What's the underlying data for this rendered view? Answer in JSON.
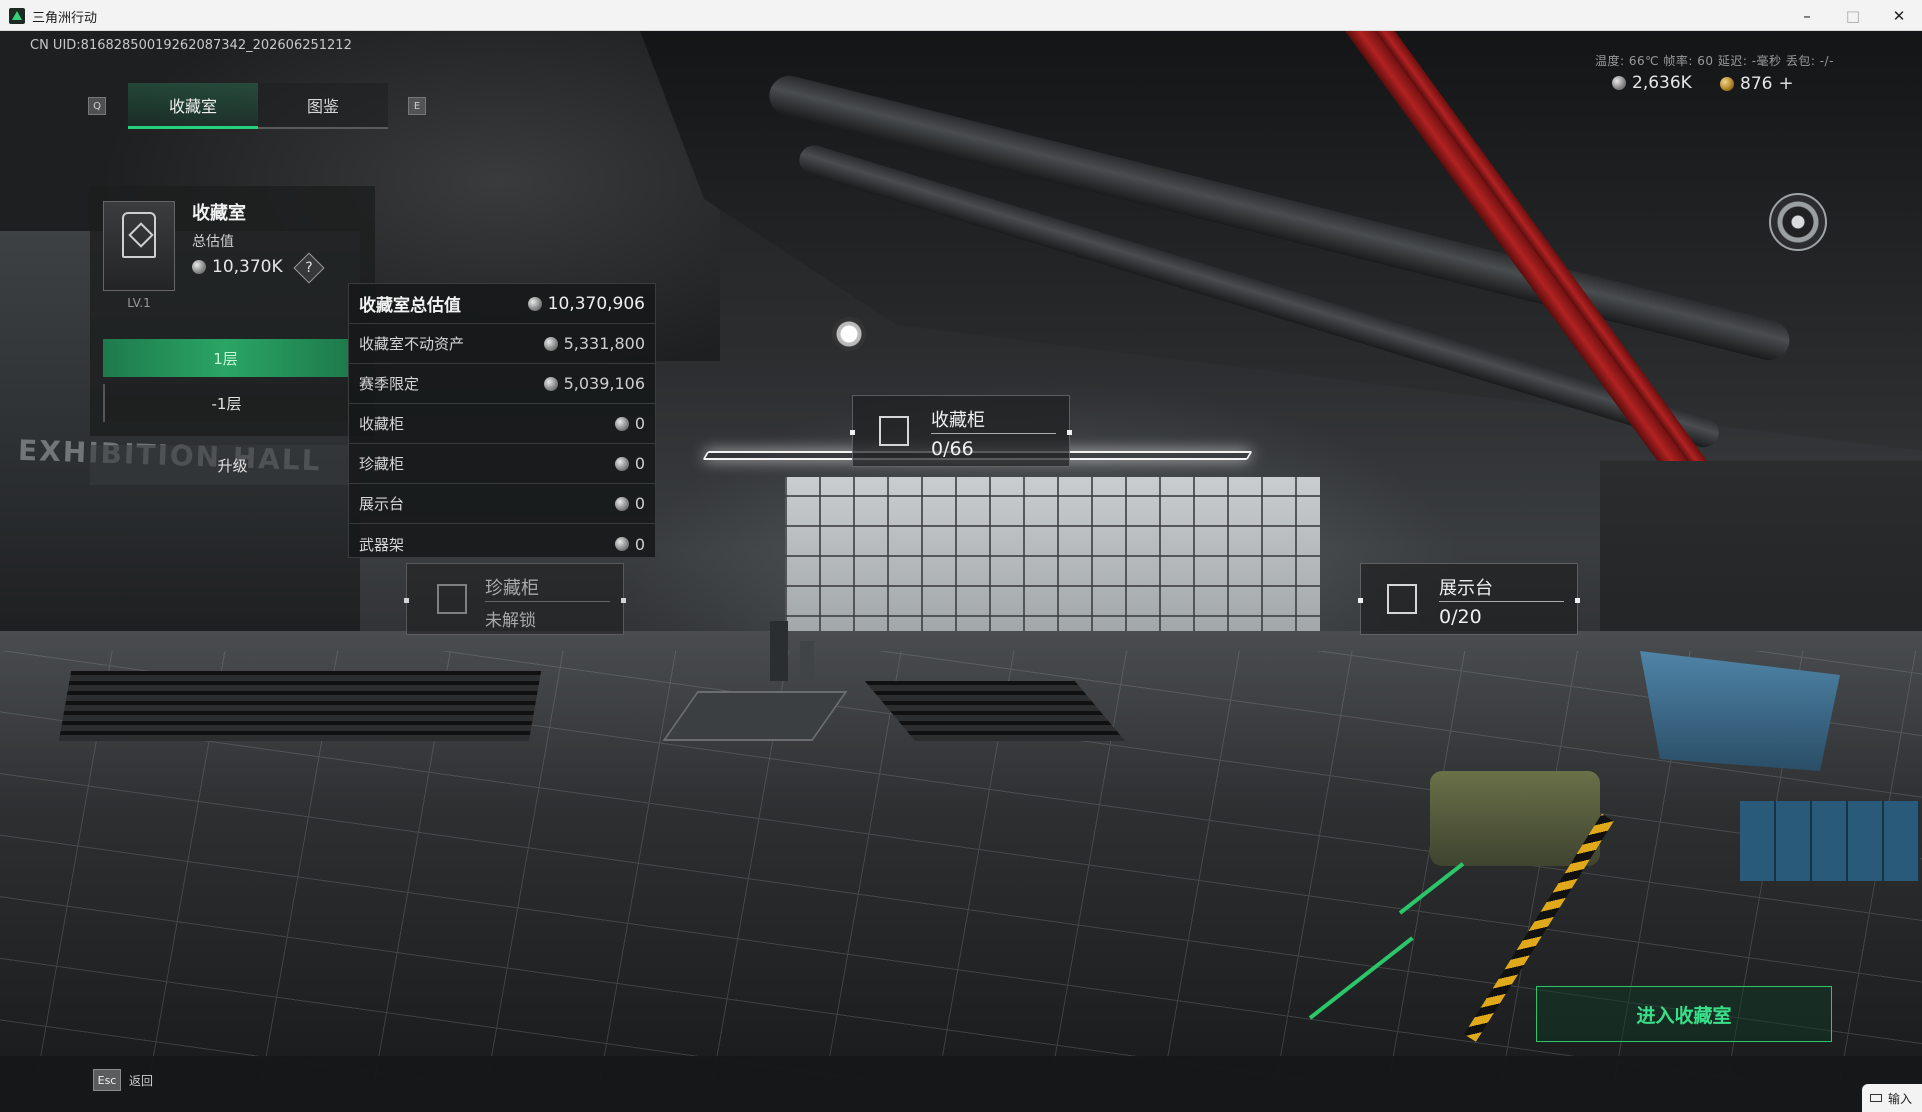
{
  "window": {
    "title": "三角洲行动",
    "minimize": "–",
    "maximize": "□",
    "close": "✕"
  },
  "hud": {
    "uid": "CN UID:8168285001926208734​2_202606251212",
    "stats": "温度:  66℃    帧率: 60    延迟: -毫秒    丢包: -/-",
    "silver": "2,636K",
    "gold": "876",
    "plus": "+"
  },
  "tabs": {
    "key_left": "Q",
    "key_right": "E",
    "items": [
      {
        "label": "收藏室",
        "active": true
      },
      {
        "label": "图鉴",
        "active": false
      }
    ]
  },
  "panel": {
    "title": "收藏室",
    "subtitle": "总估值",
    "value": "10,370K",
    "help": "?",
    "level": "LV.1",
    "floors": [
      {
        "label": "1层",
        "active": true
      },
      {
        "label": "-1层",
        "active": false
      }
    ],
    "upgrade": "升级",
    "wall_text": "EXHIBITION HALL"
  },
  "breakdown": {
    "rows": [
      {
        "label": "收藏室总估值",
        "value": "10,370,906"
      },
      {
        "label": "收藏室不动资产",
        "value": "5,331,800"
      },
      {
        "label": "赛季限定",
        "value": "5,039,106"
      },
      {
        "label": "收藏柜",
        "value": "0"
      },
      {
        "label": "珍藏柜",
        "value": "0"
      },
      {
        "label": "展示台",
        "value": "0"
      },
      {
        "label": "武器架",
        "value": "0"
      }
    ]
  },
  "hotspots": {
    "cabinet": {
      "name": "收藏柜",
      "value": "0/66"
    },
    "vault": {
      "name": "珍藏柜",
      "value": "未解锁"
    },
    "display": {
      "name": "展示台",
      "value": "0/20"
    }
  },
  "actions": {
    "enter": "进入收藏室",
    "esc_key": "Esc",
    "back": "返回"
  },
  "ime": {
    "label": "输入"
  },
  "colors": {
    "accent": "#2bc66a",
    "panel": "#1c1e1f"
  }
}
